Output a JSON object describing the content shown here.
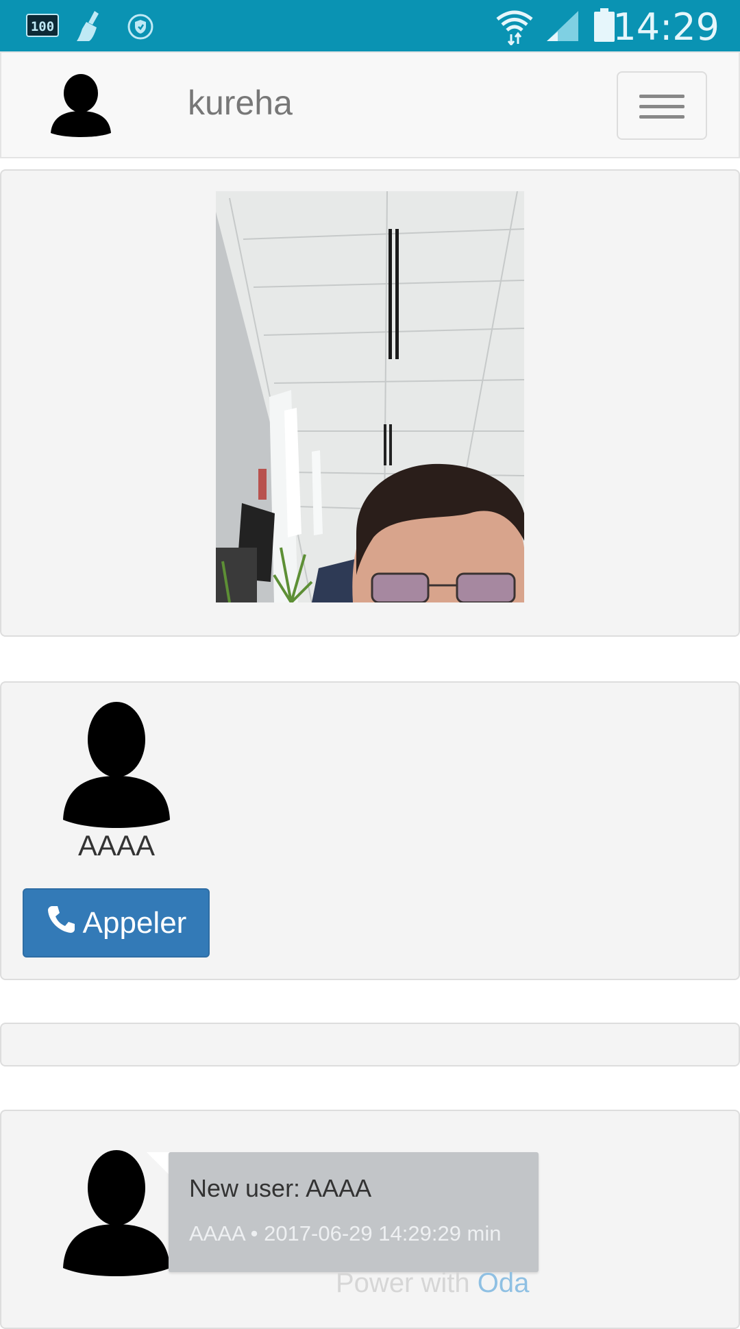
{
  "status_bar": {
    "battery_badge": "100",
    "time": "14:29",
    "icons": [
      "battery-level-badge-icon",
      "cleaner-broom-icon",
      "shield-icon",
      "wifi-icon",
      "cellular-signal-icon",
      "battery-icon"
    ]
  },
  "navbar": {
    "avatar_icon": "user-silhouette-icon",
    "title": "kureha",
    "menu_icon": "hamburger-menu-icon"
  },
  "video_panel": {
    "content": "live-camera-feed"
  },
  "user_card": {
    "avatar_icon": "user-silhouette-icon",
    "name": "AAAA",
    "call_button_label": "Appeler",
    "call_icon": "phone-icon",
    "call_button_color": "#337ab7"
  },
  "chat": {
    "avatar_icon": "user-silhouette-icon",
    "message": "New user: AAAA",
    "meta": "AAAA • 2017-06-29 14:29:29 min",
    "bubble_color": "#c2c5c8"
  },
  "footer": {
    "prefix": "Power with ",
    "brand": "Oda",
    "brand_color": "#8fc0e3"
  }
}
